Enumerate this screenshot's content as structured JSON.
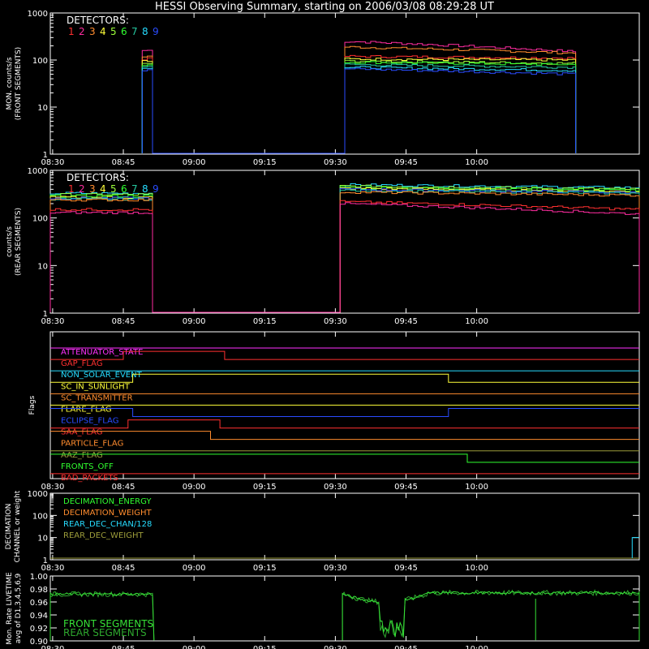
{
  "title": "HESSI Observing Summary, starting on 2006/03/08 08:29:28 UT",
  "colors": {
    "det1": "#ff3030",
    "det2": "#ff2ca0",
    "det3": "#ff8c2e",
    "det4": "#ffff3a",
    "det5": "#9cff3a",
    "det6": "#30ff30",
    "det7": "#25c8a0",
    "det8": "#26dcff",
    "det9": "#2a4cff",
    "axis": "#ffffff",
    "front": "#36e036",
    "rear": "#2ea82e"
  },
  "x_ticks": [
    "08:30",
    "08:45",
    "09:00",
    "09:15",
    "09:30",
    "09:45",
    "10:00"
  ],
  "chart_data": [
    {
      "type": "line",
      "ylabel_lines": [
        "MON. counts/s",
        "(FRONT SEGMENTS)"
      ],
      "yscale": "log",
      "ylim": [
        1,
        1000
      ],
      "y_ticks": [
        "1",
        "10",
        "100",
        "1000"
      ],
      "legend_title": "DETECTORS:",
      "legend_items": [
        "1",
        "2",
        "3",
        "4",
        "5",
        "6",
        "7",
        "8",
        "9"
      ],
      "series": [
        {
          "color_key": "det2",
          "pre": 160,
          "post": 250,
          "post_end": 150
        },
        {
          "color_key": "det3",
          "pre": 120,
          "post": 190,
          "post_end": 140
        },
        {
          "color_key": "det1",
          "pre": 105,
          "post": 120,
          "post_end": 110
        },
        {
          "color_key": "det4",
          "pre": 95,
          "post": 105,
          "post_end": 100
        },
        {
          "color_key": "det5",
          "pre": 85,
          "post": 95,
          "post_end": 85
        },
        {
          "color_key": "det6",
          "pre": 80,
          "post": 90,
          "post_end": 80
        },
        {
          "color_key": "det7",
          "pre": 75,
          "post": 80,
          "post_end": 70
        },
        {
          "color_key": "det8",
          "pre": 70,
          "post": 70,
          "post_end": 60
        },
        {
          "color_key": "det9",
          "pre": 60,
          "post": 65,
          "post_end": 50
        }
      ]
    },
    {
      "type": "line",
      "ylabel_lines": [
        "counts/s",
        "(REAR SEGMENTS)"
      ],
      "yscale": "log",
      "ylim": [
        1,
        1000
      ],
      "y_ticks": [
        "1",
        "10",
        "100",
        "1000"
      ],
      "legend_title": "DETECTORS:",
      "legend_items": [
        "1",
        "2",
        "3",
        "4",
        "5",
        "6",
        "7",
        "8",
        "9"
      ],
      "series": [
        {
          "color_key": "det8",
          "pre": 330,
          "post": 500,
          "post_end": 430
        },
        {
          "color_key": "det5",
          "pre": 310,
          "post": 470,
          "post_end": 400
        },
        {
          "color_key": "det6",
          "pre": 290,
          "post": 440,
          "post_end": 380
        },
        {
          "color_key": "det4",
          "pre": 270,
          "post": 420,
          "post_end": 360
        },
        {
          "color_key": "det9",
          "pre": 260,
          "post": 400,
          "post_end": 340
        },
        {
          "color_key": "det7",
          "pre": 250,
          "post": 380,
          "post_end": 330
        },
        {
          "color_key": "det3",
          "pre": 240,
          "post": 350,
          "post_end": 300
        },
        {
          "color_key": "det1",
          "pre": 150,
          "post": 220,
          "post_end": 150
        },
        {
          "color_key": "det2",
          "pre": 130,
          "post": 200,
          "post_end": 120
        }
      ]
    },
    {
      "type": "line",
      "ylabel": "Flags",
      "flags": [
        {
          "name": "ATTENUATOR_STATE",
          "color": "#ff30ff",
          "segments": [
            [
              0,
              125,
              0
            ]
          ]
        },
        {
          "name": "GAP_FLAG",
          "color": "#ff3030",
          "segments": [
            [
              0,
              15.5,
              0
            ],
            [
              15.5,
              37,
              1
            ],
            [
              37,
              125,
              0
            ]
          ]
        },
        {
          "name": "NON_SOLAR_EVENT",
          "color": "#26dcff",
          "segments": [
            [
              0,
              125,
              0
            ]
          ]
        },
        {
          "name": "SC_IN_SUNLIGHT",
          "color": "#ffff3a",
          "segments": [
            [
              0,
              17.5,
              0
            ],
            [
              17.5,
              84.5,
              1
            ],
            [
              84.5,
              125,
              0
            ]
          ]
        },
        {
          "name": "SC_TRANSMITTER",
          "color": "#ff8c2e",
          "segments": [
            [
              0,
              125,
              0
            ]
          ]
        },
        {
          "name": "FLARE_FLAG",
          "color": "#ffff3a",
          "segments": [
            [
              0,
              125,
              0
            ]
          ]
        },
        {
          "name": "ECLIPSE_FLAG",
          "color": "#2a4cff",
          "segments": [
            [
              0,
              17.5,
              1
            ],
            [
              17.5,
              84.5,
              0
            ],
            [
              84.5,
              125,
              1
            ]
          ]
        },
        {
          "name": "SAA_FLAG",
          "color": "#ff3030",
          "segments": [
            [
              0,
              16.5,
              0
            ],
            [
              16.5,
              36,
              1
            ],
            [
              36,
              125,
              0
            ]
          ]
        },
        {
          "name": "PARTICLE_FLAG",
          "color": "#ff8c2e",
          "segments": [
            [
              0,
              34,
              1
            ],
            [
              34,
              125,
              0
            ]
          ]
        },
        {
          "name": "AAZ_FLAG",
          "color": "#9c9c3a",
          "segments": [
            [
              0,
              125,
              0
            ]
          ]
        },
        {
          "name": "FRONTS_OFF",
          "color": "#30ff30",
          "segments": [
            [
              0,
              88.5,
              1
            ],
            [
              88.5,
              125,
              0
            ]
          ]
        },
        {
          "name": "BAD_PACKETS",
          "color": "#ff3030",
          "segments": [
            [
              0,
              125,
              0
            ]
          ]
        }
      ]
    },
    {
      "type": "line",
      "ylabel_lines": [
        "DECIMATION",
        "CHANNEL or weight"
      ],
      "yscale": "log",
      "ylim": [
        1,
        1000
      ],
      "y_ticks": [
        "1",
        "10",
        "100",
        "1000"
      ],
      "legend_items": [
        {
          "label": "DECIMATION_ENERGY",
          "color": "#30ff30"
        },
        {
          "label": "DECIMATION_WEIGHT",
          "color": "#ff8c2e"
        },
        {
          "label": "REAR_DEC_CHAN/128",
          "color": "#26dcff"
        },
        {
          "label": "REAR_DEC_WEIGHT",
          "color": "#9c9c3a"
        }
      ]
    },
    {
      "type": "line",
      "ylabel_lines": [
        "Mon. Rate LIVETIME",
        "avg of D1,3,4,5,6,9"
      ],
      "ylim": [
        0.9,
        1.0
      ],
      "y_ticks": [
        "0.90",
        "0.92",
        "0.94",
        "0.96",
        "0.98",
        "1.00"
      ],
      "legend_items": [
        {
          "label": "FRONT SEGMENTS",
          "color_key": "front"
        },
        {
          "label": "REAR SEGMENTS",
          "color_key": "rear"
        }
      ]
    }
  ]
}
